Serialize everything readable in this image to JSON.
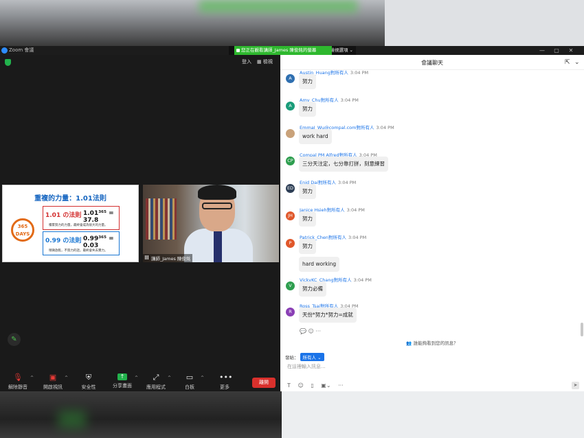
{
  "window": {
    "app_title": "Zoom 會議",
    "view_banner": "您正在觀看講師_James 陳俊銘的螢幕",
    "view_options": "檢視選項",
    "controls": [
      "—",
      "▢",
      "✕"
    ]
  },
  "meeting": {
    "signin": "登入",
    "view": "檢視",
    "slide": {
      "title": "重複的力量：1.01法則",
      "badge": "365 DAYS",
      "rule1": "1.01 の法則",
      "eq1": "1.01³⁶⁵ = 37.8",
      "note1": "積累努力的力量，最終會成為很大的力量。",
      "rule2": "0.99 の法則",
      "eq2": "0.99³⁶⁵ = 0.03",
      "note2": "稍微放鬆，不努力的話，最終會失去實力。"
    },
    "video_label": "講師_James 陳俊銘"
  },
  "toolbar": {
    "mute": "解除靜音",
    "video": "開啟視訊",
    "security": "安全性",
    "share": "分享畫面",
    "apps": "應用程式",
    "whiteboard": "白板",
    "more": "更多",
    "leave": "離開"
  },
  "chat": {
    "title": "會議聊天",
    "to_everyone": "對所有人",
    "messages": [
      {
        "sender": "Austin_Huang",
        "time": "3:04 PM",
        "avatar": "A",
        "color": "#2f6fb0",
        "text": [
          "努力"
        ]
      },
      {
        "sender": "Amy_Chu",
        "time": "3:04 PM",
        "avatar": "A",
        "color": "#1a9c7a",
        "text": [
          "努力"
        ]
      },
      {
        "sender": "EmmaJ_Wu@compal.com",
        "time": "3:04 PM",
        "avatar": "",
        "color": "#c9a27a",
        "text": [
          "work hard"
        ]
      },
      {
        "sender": "Compal PM Alfred",
        "time": "3:04 PM",
        "avatar": "CP",
        "color": "#2e9e4f",
        "text": [
          "三分天注定，七分靠打拼，刻意練習"
        ]
      },
      {
        "sender": "Enid Dai",
        "time": "3:04 PM",
        "avatar": "ED",
        "color": "#2d3e55",
        "text": [
          "努力"
        ]
      },
      {
        "sender": "Janice Hsieh",
        "time": "3:04 PM",
        "avatar": "JH",
        "color": "#e0572a",
        "text": [
          "努力"
        ]
      },
      {
        "sender": "Patrick_Chen",
        "time": "3:04 PM",
        "avatar": "P",
        "color": "#e0572a",
        "text": [
          "努力",
          "hard working"
        ]
      },
      {
        "sender": "VickyKC_Chang",
        "time": "3:04 PM",
        "avatar": "V",
        "color": "#2e9e4f",
        "text": [
          "努力必備"
        ]
      },
      {
        "sender": "Ross_Tsai",
        "time": "3:04 PM",
        "avatar": "R",
        "color": "#8a3fb5",
        "text": [
          "天份*努力*努力=成就"
        ]
      }
    ],
    "who_can_see": "誰能夠看到您的訊息？",
    "send_to_label": "發給：",
    "send_to_value": "所有人",
    "input_placeholder": "在這裡輸入訊息..."
  }
}
